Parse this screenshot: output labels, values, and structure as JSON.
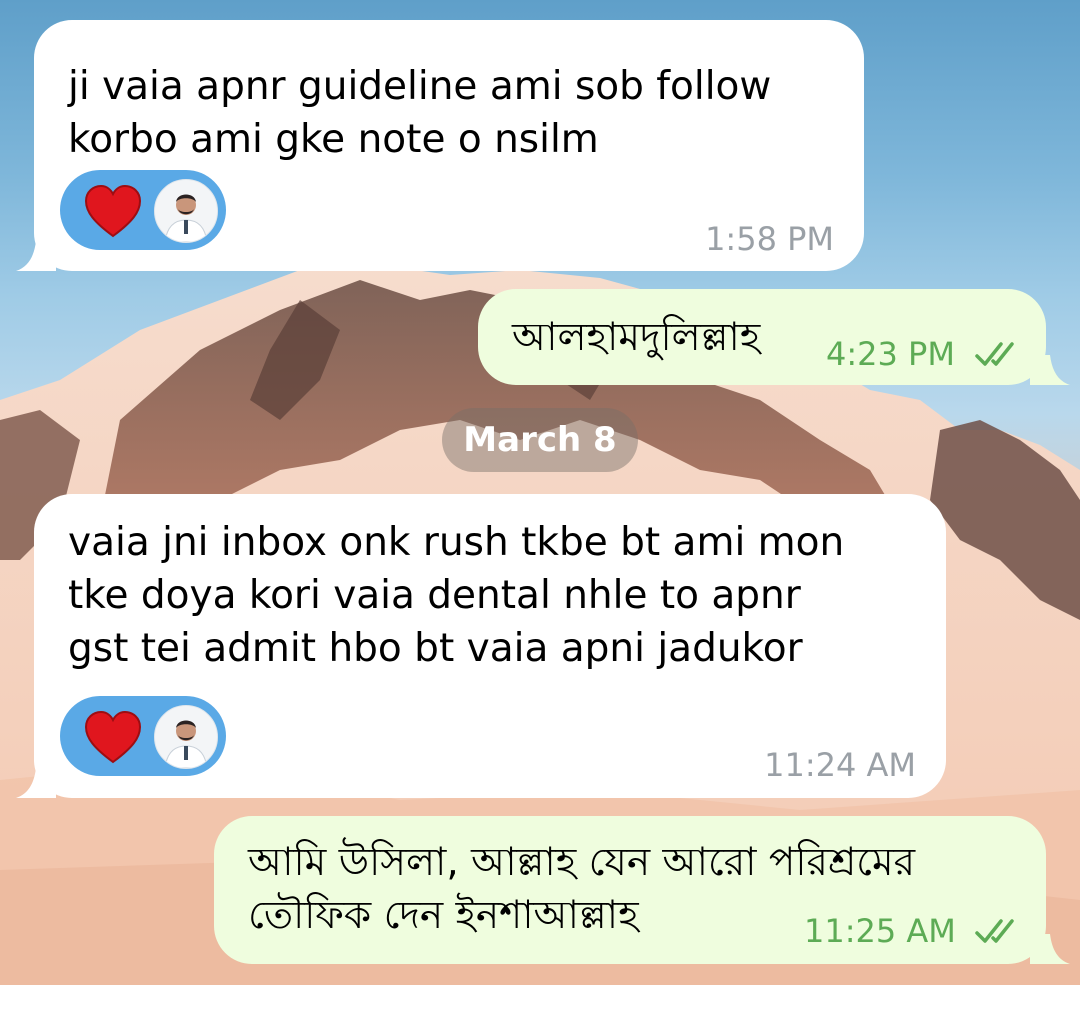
{
  "chat": {
    "date_separator": "March 8",
    "messages": [
      {
        "direction": "incoming",
        "text_lines": [
          "ji vaia apnr guideline ami sob follow",
          "korbo ami gke note o nsilm"
        ],
        "time": "1:58 PM",
        "reactions": [
          "heart-emoji",
          "reactor-avatar"
        ]
      },
      {
        "direction": "outgoing",
        "text_lines": [
          "আলহামদুলিল্লাহ"
        ],
        "time": "4:23 PM",
        "status": "read"
      },
      {
        "direction": "incoming",
        "text_lines": [
          "vaia jni inbox onk rush tkbe bt ami mon",
          "tke doya kori vaia dental nhle to apnr",
          "gst tei admit hbo bt vaia apni jadukor"
        ],
        "time": "11:24 AM",
        "reactions": [
          "heart-emoji",
          "reactor-avatar"
        ]
      },
      {
        "direction": "outgoing",
        "text_lines": [
          "আমি উসিলা, আল্লাহ যেন আরো পরিশ্রমের",
          "তৌফিক দেন ইনশাআল্লাহ"
        ],
        "time": "11:25 AM",
        "status": "read"
      }
    ]
  },
  "colors": {
    "incoming_bubble": "#ffffff",
    "outgoing_bubble": "#effdde",
    "outgoing_time": "#5dab55",
    "incoming_time": "#9aa0a6",
    "reaction_pill": "#5aa9e6",
    "heart": "#e0161e"
  },
  "icons": [
    "heart-icon",
    "double-check-icon",
    "avatar"
  ]
}
